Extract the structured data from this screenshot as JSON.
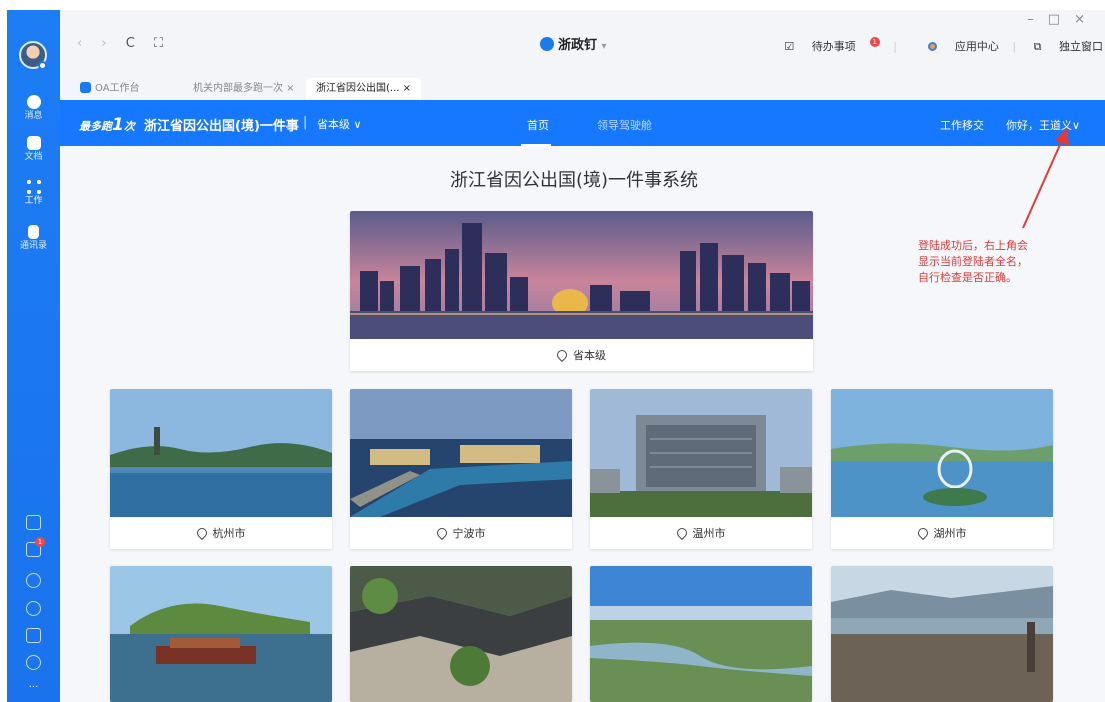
{
  "window": {
    "controls": [
      "–",
      "□",
      "×"
    ],
    "app_name": "浙政钉",
    "nav": [
      "‹",
      "›",
      "C",
      "⛶"
    ]
  },
  "top_right": {
    "todo": "待办事项",
    "todo_badge": "1",
    "app_center": "应用中心",
    "standalone": "独立窗口"
  },
  "tabs": [
    {
      "label": "OA工作台"
    },
    {
      "label": "机关内部最多跑一次"
    },
    {
      "label": "浙江省因公出国(..."
    }
  ],
  "sidebar": {
    "items": [
      {
        "label": "消息"
      },
      {
        "label": "文档"
      },
      {
        "label": "工作"
      },
      {
        "label": "通讯录"
      }
    ],
    "bottom_badge": "1",
    "more": "···"
  },
  "header": {
    "logo_text": "最多跑",
    "logo_one": "1",
    "logo_suffix": "次",
    "title": "浙江省因公出国(境)一件事",
    "separator": "|",
    "level": "省本级 ∨",
    "nav_home": "首页",
    "nav_2": "领导驾驶舱",
    "handover": "工作移交",
    "greeting": "你好，王道义∨"
  },
  "main": {
    "page_title": "浙江省因公出国(境)一件事系统",
    "featured": {
      "label": "省本级"
    },
    "cities": [
      {
        "label": "杭州市"
      },
      {
        "label": "宁波市"
      },
      {
        "label": "温州市"
      },
      {
        "label": "湖州市"
      }
    ]
  },
  "annotation": {
    "lines": [
      "登陆成功后，右上角会",
      "显示当前登陆者全名，",
      "自行检查是否正确。"
    ],
    "color": "#e03a3a"
  },
  "colors": {
    "brand_blue": "#1677ff",
    "sidebar_blue": "#1a73ec"
  }
}
